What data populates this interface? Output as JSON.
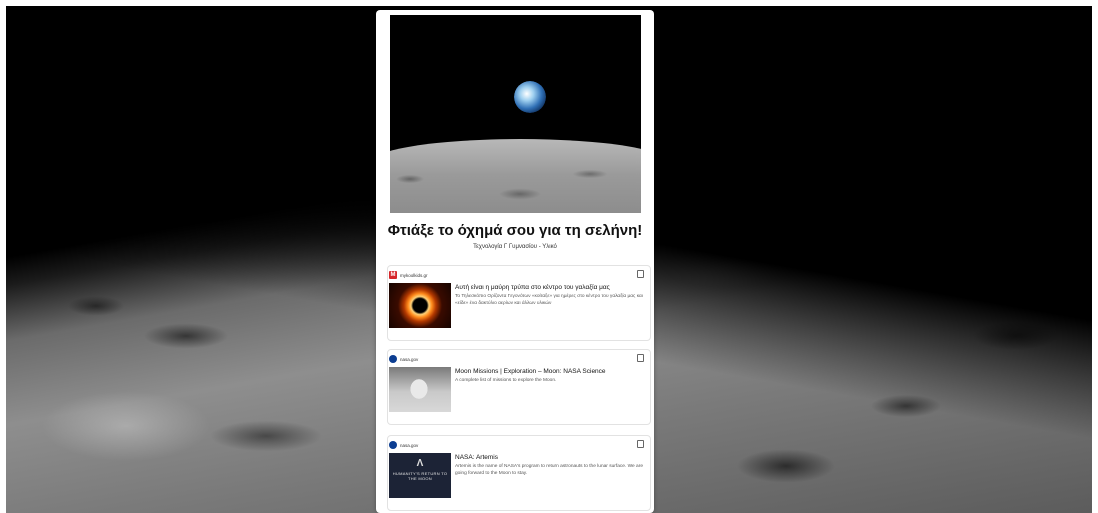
{
  "page": {
    "title": "Φτιάξε το όχημά σου για τη σελήνη!",
    "subtitle": "Τεχνολογία Γ Γυμνασίου - Υλικό"
  },
  "cards": [
    {
      "source": "mykoolkids.gr",
      "favicon_letter": "M",
      "title": "Αυτή είναι η μαύρη τρύπα στο κέντρο του γαλαξία μας",
      "description": "Το Τηλεσκόπιο Ορίζοντα Γεγονότων «κοίταξε» για ημέρες στο κέντρο του γαλαξία μας και «είδε» ένα δακτύλιο αερίων και άλλων υλικών",
      "icon": "black-hole-thumbnail"
    },
    {
      "source": "nasa.gov",
      "title": "Moon Missions | Exploration – Moon: NASA Science",
      "description": "A complete list of missions to explore the Moon.",
      "icon": "astronaut-thumbnail"
    },
    {
      "source": "nasa.gov",
      "title": "NASA: Artemis",
      "description": "Artemis is the name of NASA's program to return astronauts to the lunar surface. We are going forward to the Moon to stay.",
      "thumb_text": "HUMANITY'S RETURN TO THE MOON",
      "icon": "artemis-thumbnail"
    }
  ],
  "colors": {
    "panel_bg": "#ffffff",
    "favicon_m": "#d6262a",
    "favicon_nasa": "#0b3d91"
  }
}
